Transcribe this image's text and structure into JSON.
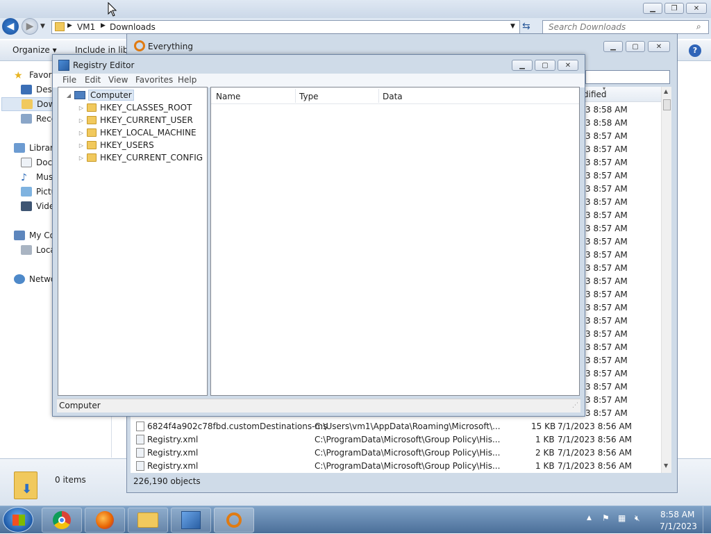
{
  "explorer": {
    "path": [
      "VM1",
      "Downloads"
    ],
    "search_placeholder": "Search Downloads",
    "toolbar": {
      "organize": "Organize ▾",
      "include": "Include in libr"
    },
    "nav": [
      {
        "label": "Favorit",
        "icon": "star-icon"
      },
      {
        "label": "Desk",
        "icon": "desktop-icon"
      },
      {
        "label": "Dow",
        "icon": "downloads-icon"
      },
      {
        "label": "Rece",
        "icon": "recent-places-icon"
      },
      {
        "label": "Librari",
        "icon": "libraries-icon"
      },
      {
        "label": "Docu",
        "icon": "documents-icon"
      },
      {
        "label": "Mus",
        "icon": "music-icon"
      },
      {
        "label": "Pictu",
        "icon": "pictures-icon"
      },
      {
        "label": "Vide",
        "icon": "videos-icon"
      },
      {
        "label": "My Co",
        "icon": "computer-icon"
      },
      {
        "label": "Loca",
        "icon": "local-disk-icon"
      },
      {
        "label": "Netwo",
        "icon": "network-icon"
      }
    ],
    "details_count": "0 items",
    "help_icon": "?"
  },
  "everything": {
    "title": "Everything",
    "column_modified": "dified",
    "partial_times": [
      "3 8:58 AM",
      "3 8:58 AM",
      "3 8:57 AM",
      "3 8:57 AM",
      "3 8:57 AM",
      "3 8:57 AM",
      "3 8:57 AM",
      "3 8:57 AM",
      "3 8:57 AM",
      "3 8:57 AM",
      "3 8:57 AM",
      "3 8:57 AM",
      "3 8:57 AM",
      "3 8:57 AM",
      "3 8:57 AM",
      "3 8:57 AM",
      "3 8:57 AM",
      "3 8:57 AM",
      "3 8:57 AM",
      "3 8:57 AM",
      "3 8:57 AM",
      "3 8:57 AM",
      "3 8:57 AM",
      "3 8:57 AM"
    ],
    "rows": [
      {
        "name": "6824f4a902c78fbd.customDestinations-ms",
        "path": "C:\\Users\\vm1\\AppData\\Roaming\\Microsoft\\...",
        "size": "15 KB",
        "modified": "7/1/2023 8:56 AM"
      },
      {
        "name": "Registry.xml",
        "path": "C:\\ProgramData\\Microsoft\\Group Policy\\His...",
        "size": "1 KB",
        "modified": "7/1/2023 8:56 AM"
      },
      {
        "name": "Registry.xml",
        "path": "C:\\ProgramData\\Microsoft\\Group Policy\\His...",
        "size": "2 KB",
        "modified": "7/1/2023 8:56 AM"
      },
      {
        "name": "Registry.xml",
        "path": "C:\\ProgramData\\Microsoft\\Group Policy\\His...",
        "size": "1 KB",
        "modified": "7/1/2023 8:56 AM"
      }
    ],
    "status": "226,190 objects"
  },
  "regedit": {
    "title": "Registry Editor",
    "menu": [
      "File",
      "Edit",
      "View",
      "Favorites",
      "Help"
    ],
    "tree_root": "Computer",
    "tree_children": [
      "HKEY_CLASSES_ROOT",
      "HKEY_CURRENT_USER",
      "HKEY_LOCAL_MACHINE",
      "HKEY_USERS",
      "HKEY_CURRENT_CONFIG"
    ],
    "columns": [
      "Name",
      "Type",
      "Data"
    ],
    "status": "Computer"
  },
  "taskbar": {
    "apps": [
      "chrome-icon",
      "firefox-icon",
      "file-explorer-icon",
      "registry-editor-icon",
      "everything-search-icon"
    ],
    "clock_time": "8:58 AM",
    "clock_date": "7/1/2023"
  }
}
